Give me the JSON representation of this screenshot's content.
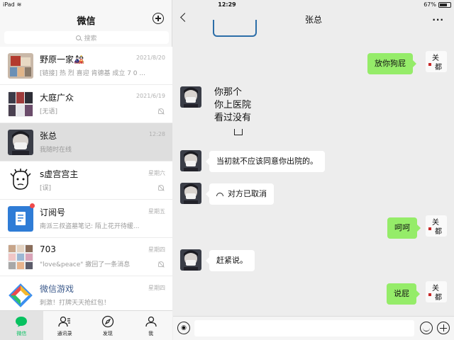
{
  "status_bar": {
    "device": "iPad",
    "time": "12:29",
    "battery_percent": "67%",
    "battery_level": 0.67
  },
  "sidebar": {
    "title": "微信",
    "search_placeholder": "搜索",
    "chats": [
      {
        "name": "野原一家🎎",
        "preview": "[链接] 热 烈 喜迎 肯德基 成立 7 0 ...",
        "time": "2021/8/20",
        "muted": false,
        "active": false,
        "name_link": false,
        "unread": false
      },
      {
        "name": "大庭广众",
        "preview": "[无语]",
        "time": "2021/6/19",
        "muted": true,
        "active": false,
        "name_link": false,
        "unread": false
      },
      {
        "name": "张总",
        "preview": "我随时在线",
        "time": "12:28",
        "muted": false,
        "active": true,
        "name_link": false,
        "unread": false
      },
      {
        "name": "s虚宫宫主",
        "preview": "[误]",
        "time": "星期六",
        "muted": true,
        "active": false,
        "name_link": false,
        "unread": false
      },
      {
        "name": "订阅号",
        "preview": "南派三叔盗墓笔记: 陌上花开待缓...",
        "time": "星期五",
        "muted": false,
        "active": false,
        "name_link": false,
        "unread": true
      },
      {
        "name": "703",
        "preview": "\"love&peace\" 撤回了一条消息",
        "time": "星期四",
        "muted": true,
        "active": false,
        "name_link": false,
        "unread": false
      },
      {
        "name": "微信游戏",
        "preview": "刺激！打牌天天抢红包！",
        "time": "星期四",
        "muted": false,
        "active": false,
        "name_link": true,
        "unread": false
      }
    ]
  },
  "tabs": [
    {
      "label": "微信",
      "icon": "chat-bubble-icon",
      "active": true
    },
    {
      "label": "通讯录",
      "icon": "contacts-icon",
      "active": false
    },
    {
      "label": "发现",
      "icon": "compass-icon",
      "active": false
    },
    {
      "label": "我",
      "icon": "person-icon",
      "active": false
    }
  ],
  "conversation": {
    "title": "张总",
    "more": "···",
    "messages": [
      {
        "dir": "out",
        "text": "放你狗屁"
      },
      {
        "dir": "in",
        "type": "sticker",
        "text": "你那个\n你上医院\n看过没有"
      },
      {
        "dir": "in",
        "text": "当初就不应该同意你出院的。"
      },
      {
        "dir": "in",
        "text": "对方已取消",
        "icon": "phone-hangup-icon"
      },
      {
        "dir": "out",
        "text": "呵呵"
      },
      {
        "dir": "in",
        "text": "赶紧说。"
      },
      {
        "dir": "out",
        "text": "说屁"
      }
    ]
  },
  "colors": {
    "accent": "#07c160",
    "bubble_out": "#95ec69",
    "bubble_in": "#ffffff",
    "link": "#3d5b8c"
  }
}
